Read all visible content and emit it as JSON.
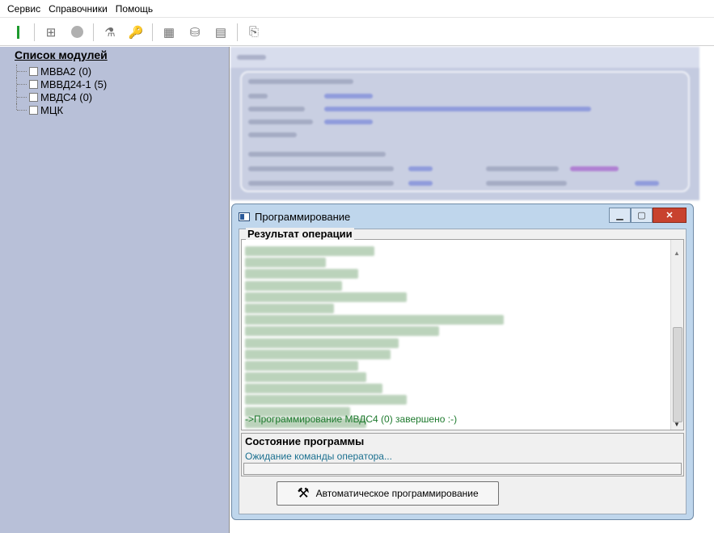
{
  "menu": [
    "Сервис",
    "Справочники",
    "Помощь"
  ],
  "toolbar": {
    "icons": [
      "green-bar-icon",
      "chip-icon",
      "gray-circle-icon",
      "wand-icon",
      "key-icon",
      "grid-icon",
      "db-icon",
      "monitor-icon",
      "exit-icon"
    ]
  },
  "sidebar": {
    "title": "Список модулей",
    "items": [
      {
        "label": "МВВА2 (0)"
      },
      {
        "label": "МВВД24-1 (5)"
      },
      {
        "label": "МВДС4 (0)"
      },
      {
        "label": "МЦК"
      }
    ]
  },
  "prog_window": {
    "title": "Программирование",
    "result_label": "Результат операции",
    "log_last": "->Программирование МВДС4 (0) завершено :-)",
    "state_label": "Состояние программы",
    "state_text": "Ожидание команды оператора...",
    "auto_button": "Автоматическое программирование"
  },
  "colors": {
    "sidebar_bg": "#b8c0d8",
    "window_frame": "#bfd6ec",
    "log_text": "#1e7a2e",
    "state_text": "#1a6f8f",
    "close_button": "#c8422e"
  }
}
